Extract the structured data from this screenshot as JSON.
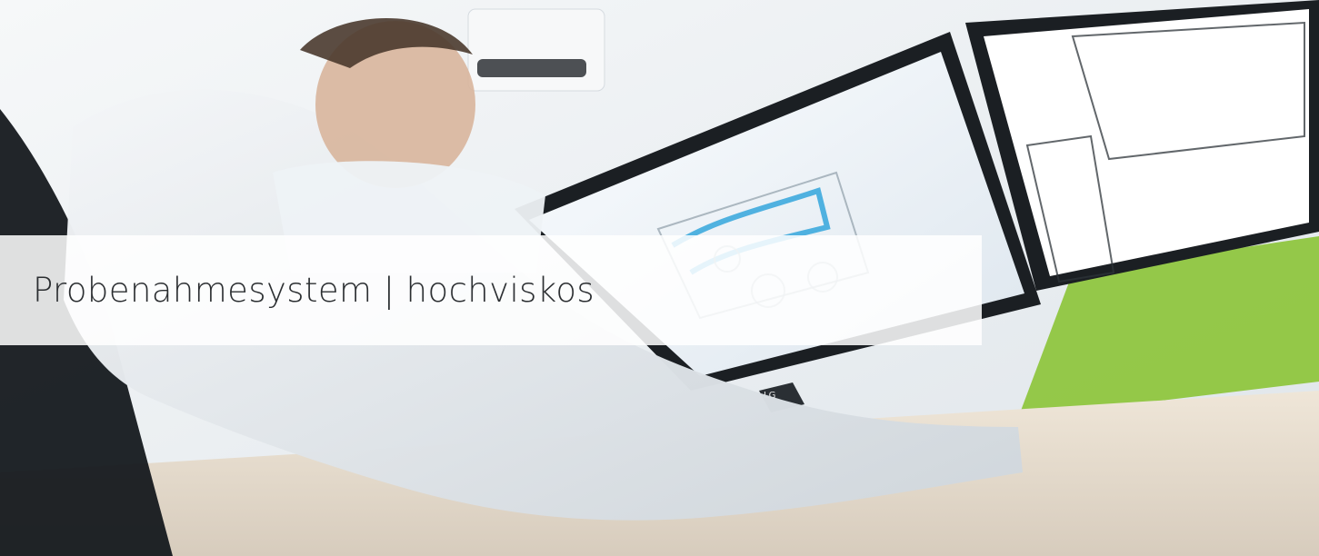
{
  "hero": {
    "title": "Probenahmesystem | hochviskos",
    "image": {
      "description": "",
      "monitor_brand_left": "LG"
    }
  },
  "colors": {
    "band": "#ffffff",
    "title_text": "#2b2e31",
    "accent_green": "#8fc63f",
    "cad_blue": "#34a6dc"
  }
}
